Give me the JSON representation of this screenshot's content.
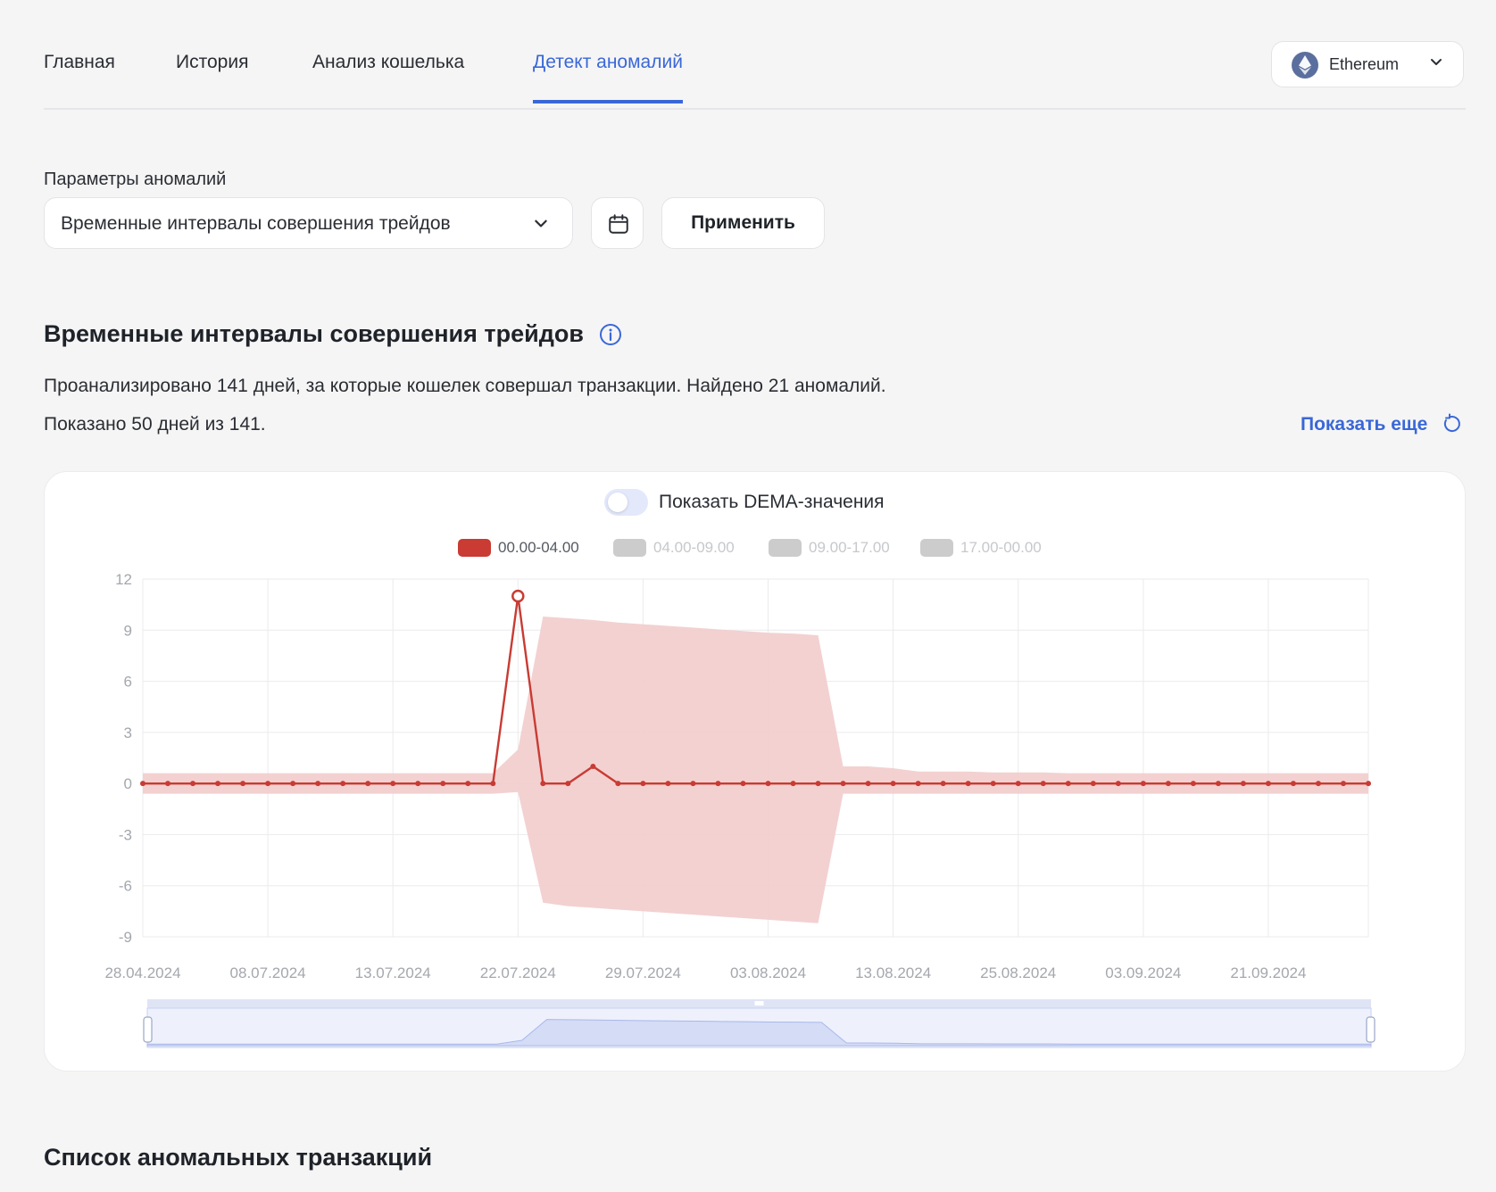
{
  "nav": {
    "tabs": [
      {
        "label": "Главная",
        "active": false
      },
      {
        "label": "История",
        "active": false
      },
      {
        "label": "Анализ кошелька",
        "active": false
      },
      {
        "label": "Детект аномалий",
        "active": true
      }
    ],
    "network": {
      "label": "Ethereum",
      "icon": "ethereum-icon"
    }
  },
  "params": {
    "label": "Параметры аномалий",
    "selected": "Временные интервалы совершения трейдов",
    "calendar_icon": "calendar-icon",
    "apply_label": "Применить"
  },
  "section": {
    "title": "Временные интервалы совершения трейдов",
    "summary": "Проанализировано 141 дней, за которые кошелек совершал транзакции. Найдено 21 аномалий.",
    "shown": "Показано 50 дней из 141.",
    "show_more": "Показать еще"
  },
  "toggle": {
    "label": "Показать DEMA-значения",
    "on": false
  },
  "legend": [
    {
      "label": "00.00-04.00",
      "color": "#c93b33",
      "active": true
    },
    {
      "label": "04.00-09.00",
      "color": "#cccccc",
      "active": false
    },
    {
      "label": "09.00-17.00",
      "color": "#cccccc",
      "active": false
    },
    {
      "label": "17.00-00.00",
      "color": "#cccccc",
      "active": false
    }
  ],
  "chart_data": {
    "type": "line",
    "x_tick_labels": [
      "28.04.2024",
      "08.07.2024",
      "13.07.2024",
      "22.07.2024",
      "29.07.2024",
      "03.08.2024",
      "13.08.2024",
      "25.08.2024",
      "03.09.2024",
      "21.09.2024"
    ],
    "y_ticks": [
      12,
      9,
      6,
      3,
      0,
      -3,
      -6,
      -9
    ],
    "ylim": [
      -9,
      12
    ],
    "series": [
      {
        "name": "00.00-04.00",
        "color": "#c93b33",
        "values": [
          0,
          0,
          0,
          0,
          0,
          0,
          0,
          0,
          0,
          0,
          0,
          0,
          0,
          0,
          0,
          11,
          0,
          0,
          1,
          0,
          0,
          0,
          0,
          0,
          0,
          0,
          0,
          0,
          0,
          0,
          0,
          0,
          0,
          0,
          0,
          0,
          0,
          0,
          0,
          0,
          0,
          0,
          0,
          0,
          0,
          0,
          0,
          0,
          0,
          0
        ],
        "highlight_index": 15
      }
    ],
    "band": {
      "color": "#f2cfcf",
      "upper": [
        0.6,
        0.6,
        0.6,
        0.6,
        0.6,
        0.6,
        0.6,
        0.6,
        0.6,
        0.6,
        0.6,
        0.6,
        0.6,
        0.6,
        0.6,
        2.0,
        9.8,
        9.7,
        9.6,
        9.45,
        9.35,
        9.25,
        9.15,
        9.05,
        8.95,
        8.85,
        8.8,
        8.7,
        1.0,
        1.0,
        0.9,
        0.7,
        0.7,
        0.7,
        0.65,
        0.65,
        0.65,
        0.6,
        0.6,
        0.6,
        0.6,
        0.6,
        0.6,
        0.6,
        0.6,
        0.6,
        0.6,
        0.6,
        0.6,
        0.6
      ],
      "lower": [
        -0.6,
        -0.6,
        -0.6,
        -0.6,
        -0.6,
        -0.6,
        -0.6,
        -0.6,
        -0.6,
        -0.6,
        -0.6,
        -0.6,
        -0.6,
        -0.6,
        -0.6,
        -0.5,
        -7.0,
        -7.2,
        -7.3,
        -7.4,
        -7.5,
        -7.6,
        -7.7,
        -7.8,
        -7.9,
        -8.0,
        -8.1,
        -8.2,
        -0.6,
        -0.6,
        -0.6,
        -0.6,
        -0.6,
        -0.6,
        -0.6,
        -0.6,
        -0.6,
        -0.6,
        -0.6,
        -0.6,
        -0.6,
        -0.6,
        -0.6,
        -0.6,
        -0.6,
        -0.6,
        -0.6,
        -0.6,
        -0.6,
        -0.6
      ]
    },
    "grid": true,
    "zoom_slider": {
      "start": 0,
      "end": 1
    }
  },
  "list": {
    "title": "Список аномальных транзакций"
  }
}
